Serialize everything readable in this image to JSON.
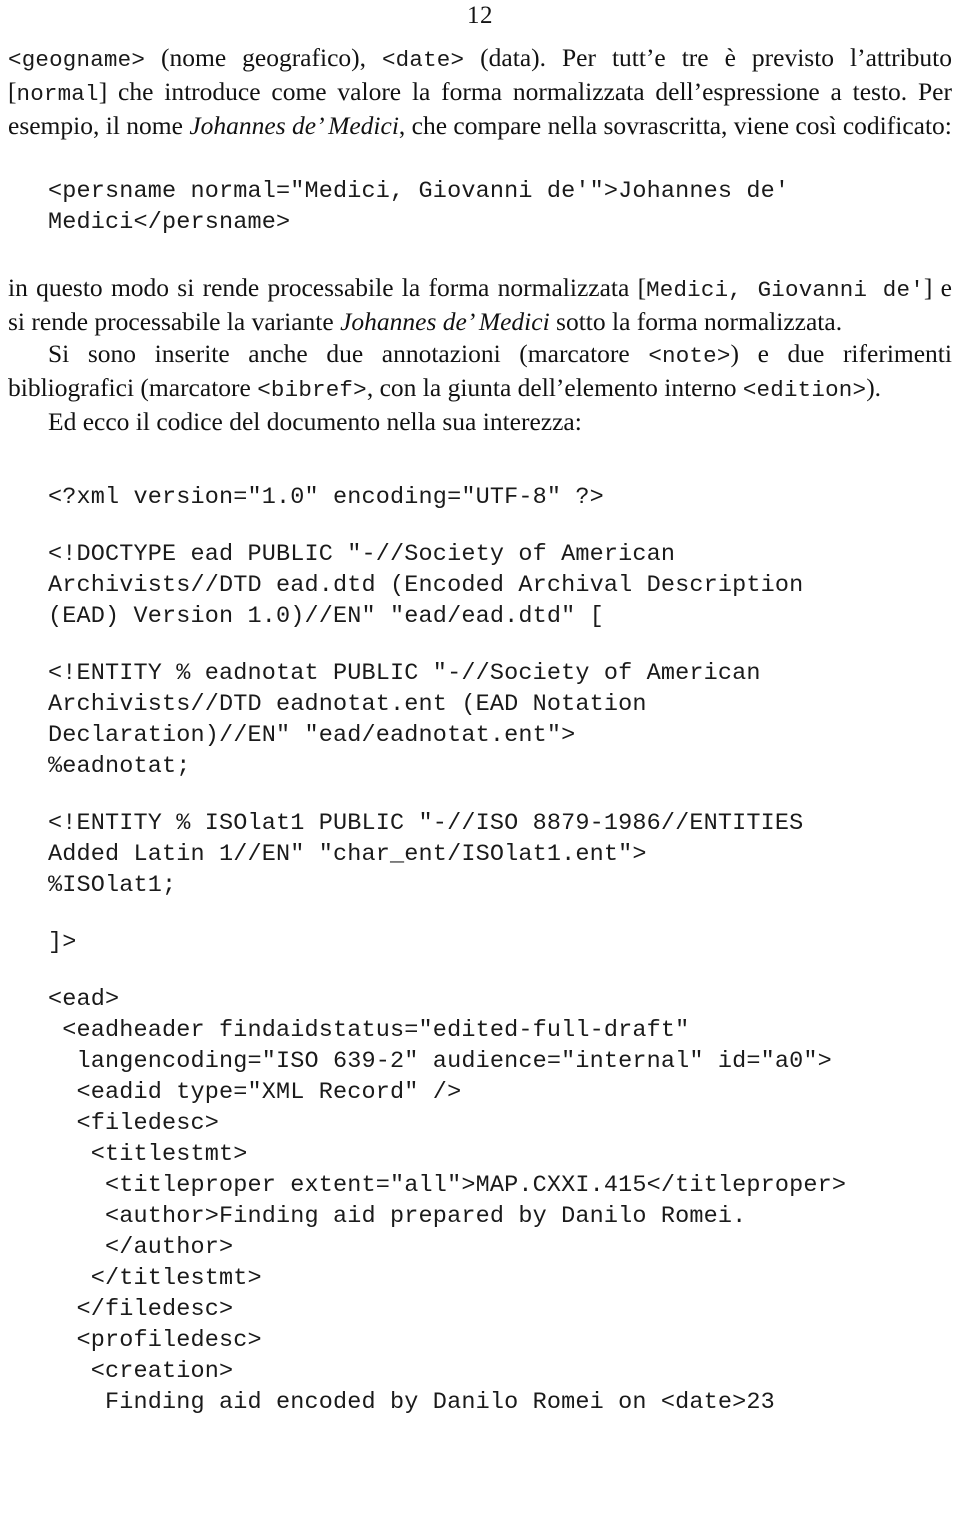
{
  "page": {
    "folio": "12"
  },
  "paragraphs": {
    "p1": {
      "seg1_code": "<geogname>",
      "seg2": " (nome geografico), ",
      "seg3_code": "<date>",
      "seg4": " (data). Per tutt’e tre è previsto l’attributo [",
      "seg5_code": "normal",
      "seg6": "] che introduce come valore la forma normalizzata dell’espressione a testo. Per esempio, il nome ",
      "seg7_italic": "Johannes de’ Medici",
      "seg8": ", che compare nella sovrascritta, viene così codificato:"
    },
    "p2": {
      "seg1": "in questo modo si rende processabile la forma normalizzata [",
      "seg2_code": "Medici, Giovanni de'",
      "seg3": "] e si rende processabile la variante ",
      "seg4_italic": "Johannes de’ Medici",
      "seg5": " sotto la forma normalizzata."
    },
    "p3": {
      "seg1": "Si sono inserite anche due annotazioni (marcatore ",
      "seg2_code": "<note>",
      "seg3": ") e due riferimenti bibliografici (marcatore ",
      "seg4_code": "<bibref>",
      "seg5": ", con la giunta dell’elemento interno ",
      "seg6_code": "<edition>",
      "seg7": ")."
    },
    "p4": {
      "text": "Ed ecco il codice del documento nella sua interezza:"
    }
  },
  "code_blocks": {
    "persname": "<persname normal=\"Medici, Giovanni de'\">Johannes de'\nMedici</persname>",
    "xml_decl": "<?xml version=\"1.0\" encoding=\"UTF-8\" ?>",
    "doctype": "<!DOCTYPE ead PUBLIC \"-//Society of American\nArchivists//DTD ead.dtd (Encoded Archival Description\n(EAD) Version 1.0)//EN\" \"ead/ead.dtd\" [",
    "entity_eadnotat": "<!ENTITY % eadnotat PUBLIC \"-//Society of American\nArchivists//DTD eadnotat.ent (EAD Notation\nDeclaration)//EN\" \"ead/eadnotat.ent\">\n%eadnotat;",
    "entity_isolat1": "<!ENTITY % ISOlat1 PUBLIC \"-//ISO 8879-1986//ENTITIES\nAdded Latin 1//EN\" \"char_ent/ISOlat1.ent\">\n%ISOlat1;",
    "subset_close": "]>",
    "ead_body": "<ead>\n <eadheader findaidstatus=\"edited-full-draft\"\n  langencoding=\"ISO 639-2\" audience=\"internal\" id=\"a0\">\n  <eadid type=\"XML Record\" />\n  <filedesc>\n   <titlestmt>\n    <titleproper extent=\"all\">MAP.CXXI.415</titleproper>\n    <author>Finding aid prepared by Danilo Romei.\n    </author>\n   </titlestmt>\n  </filedesc>\n  <profiledesc>\n   <creation>\n    Finding aid encoded by Danilo Romei on <date>23"
  }
}
